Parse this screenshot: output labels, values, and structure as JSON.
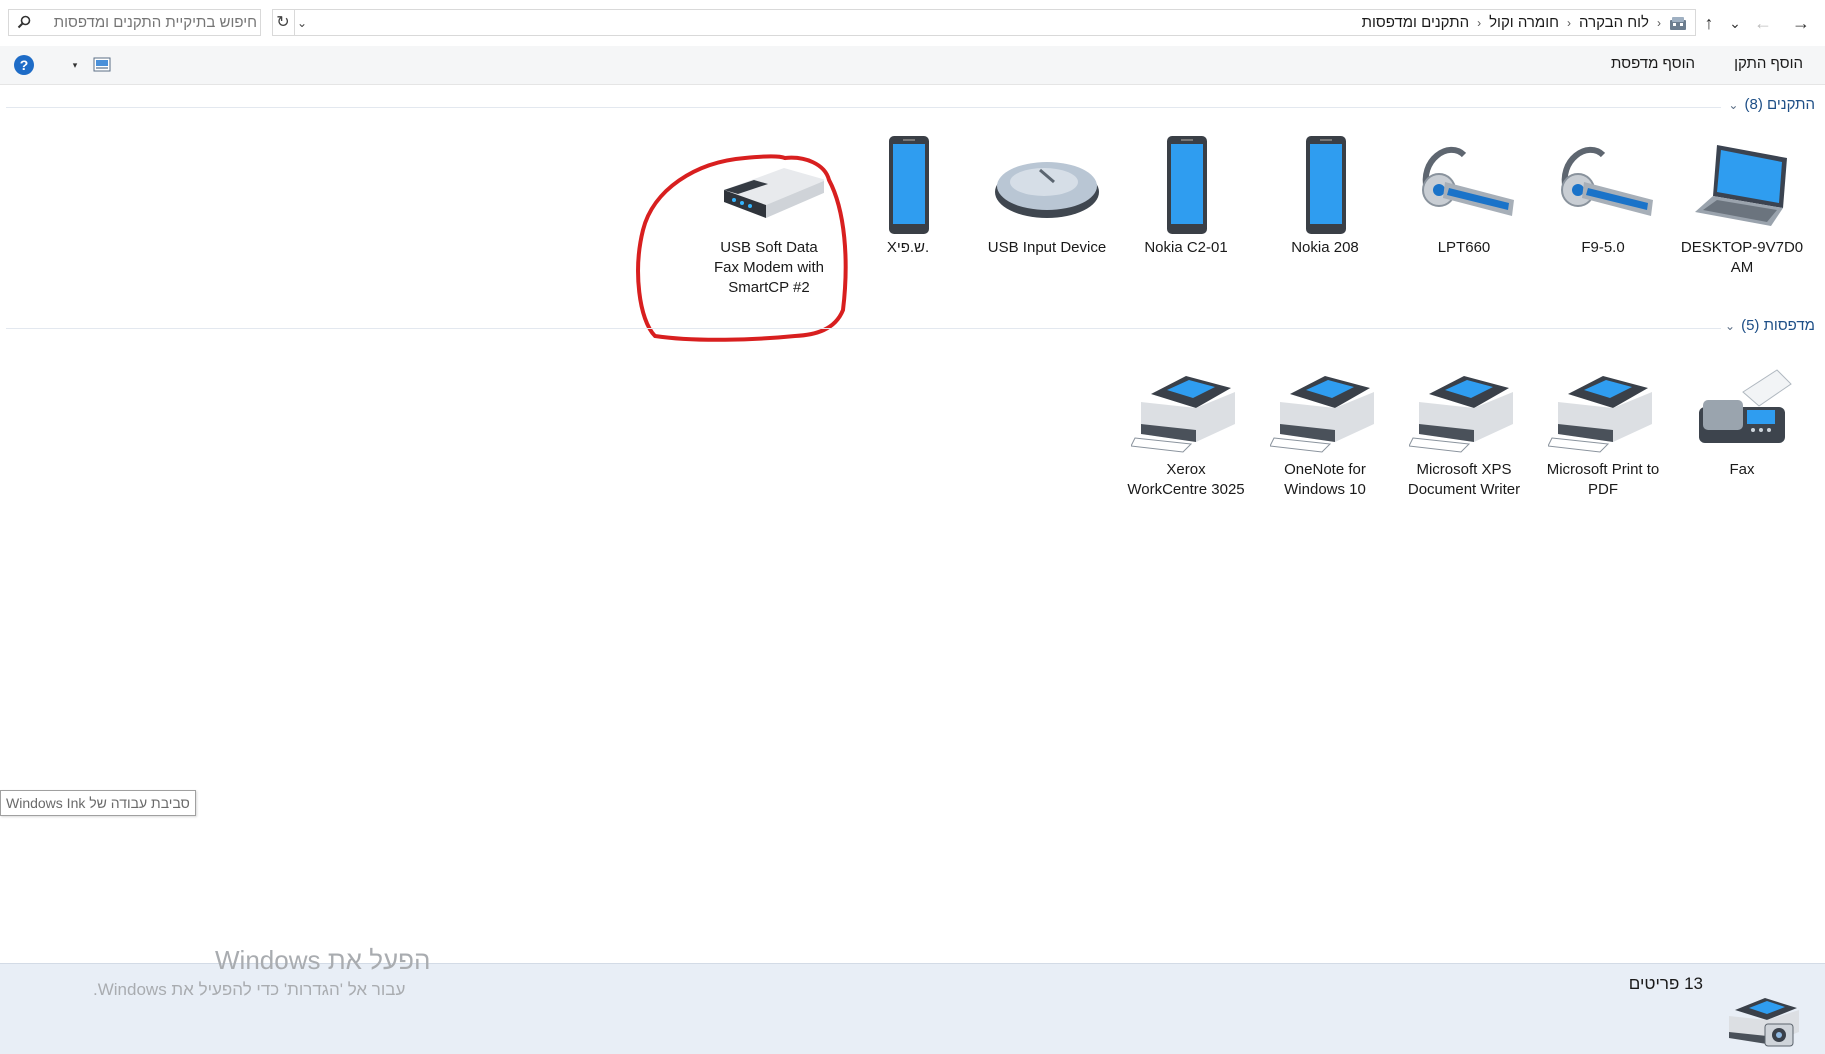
{
  "nav": {
    "back_glyph": "→",
    "forward_glyph": "←",
    "recent_glyph": "⌄",
    "up_glyph": "↑"
  },
  "address": {
    "crumbs": [
      "לוח הבקרה",
      "חומרה וקול",
      "התקנים ומדפסות"
    ],
    "separator": "›",
    "dropdown_glyph": "⌄",
    "refresh_glyph": "↻"
  },
  "search": {
    "placeholder": "חיפוש בתיקיית התקנים ומדפסות"
  },
  "commands": {
    "add_device": "הוסף התקן",
    "add_printer": "הוסף מדפסת",
    "help_glyph": "?",
    "view_dropdown_glyph": "▾"
  },
  "groups": {
    "devices": {
      "title": "התקנים (8)",
      "chevron": "⌄"
    },
    "printers": {
      "title": "מדפסות (5)",
      "chevron": "⌄"
    }
  },
  "devices": [
    {
      "label": "DESKTOP-9V7D0\nAM",
      "icon": "laptop-icon"
    },
    {
      "label": "F9-5.0",
      "icon": "headset-icon"
    },
    {
      "label": "LPT660",
      "icon": "headset-icon"
    },
    {
      "label": "Nokia 208",
      "icon": "phone-icon"
    },
    {
      "label": "Nokia C2-01",
      "icon": "phone-icon"
    },
    {
      "label": "USB Input Device",
      "icon": "mouse-icon"
    },
    {
      "label": "Xש.פי.",
      "icon": "phone-icon"
    },
    {
      "label": "USB Soft Data\nFax Modem with\nSmartCP #2",
      "icon": "modem-icon"
    }
  ],
  "printers": [
    {
      "label": "Fax",
      "icon": "fax-icon"
    },
    {
      "label": "Microsoft Print to\nPDF",
      "icon": "printer-icon"
    },
    {
      "label": "Microsoft XPS\nDocument Writer",
      "icon": "printer-icon"
    },
    {
      "label": "OneNote for\nWindows 10",
      "icon": "printer-icon"
    },
    {
      "label": "Xerox\nWorkCentre 3025",
      "icon": "printer-icon"
    }
  ],
  "ink_tooltip": "סביבת עבודה של Windows Ink",
  "details": {
    "count": "13 פריטים"
  },
  "watermark": {
    "title": "הפעל את Windows",
    "subtitle": "עבור אל 'הגדרות' כדי להפעיל את Windows."
  },
  "colors": {
    "annotation": "#d81f1f",
    "group_header": "#1e4f87",
    "details_bg": "#e8eef6",
    "help_blue": "#1e6cc7"
  }
}
